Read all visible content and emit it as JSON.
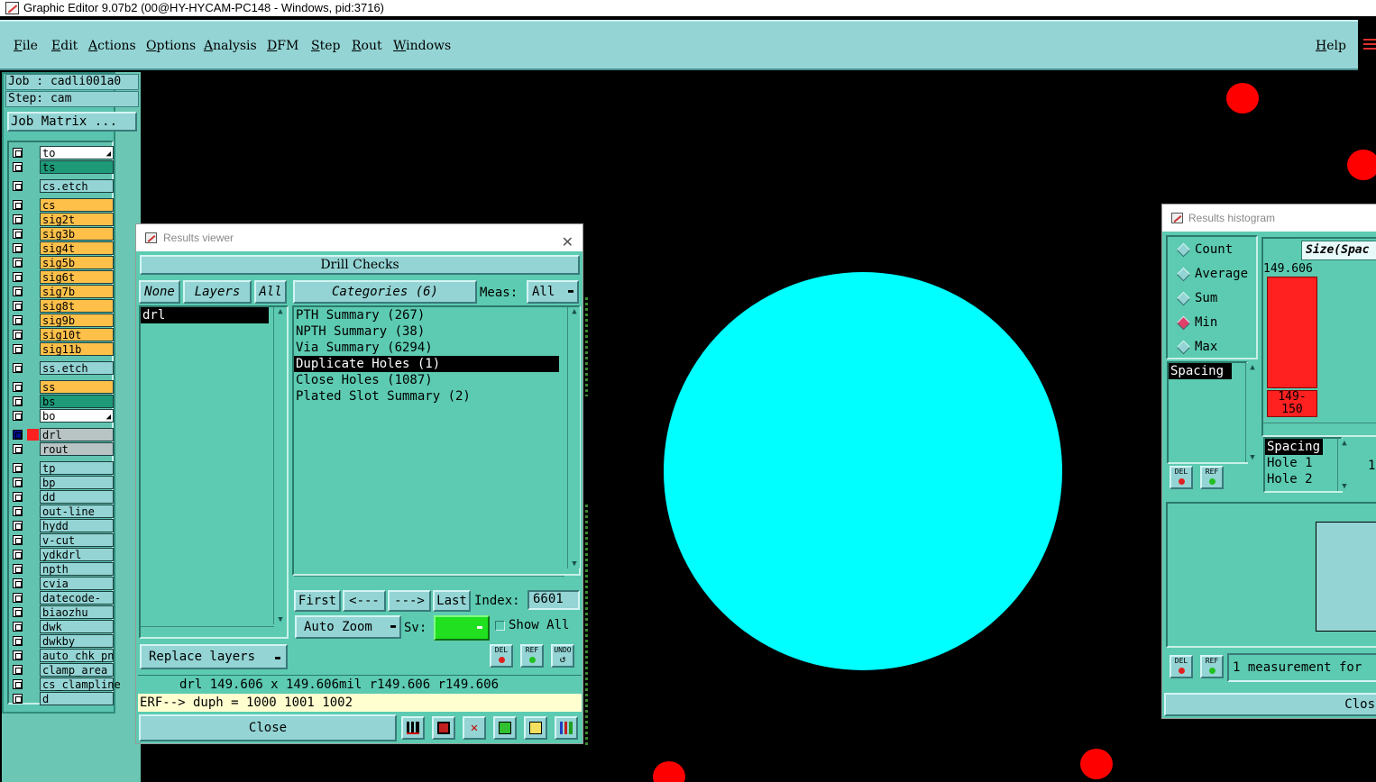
{
  "window": {
    "title": "Graphic Editor 9.07b2 (00@HY-HYCAM-PC148 - Windows, pid:3716)"
  },
  "menu": {
    "items": [
      "File",
      "Edit",
      "Actions",
      "Options",
      "Analysis",
      "DFM",
      "Step",
      "Rout",
      "Windows"
    ],
    "help": "Help"
  },
  "left_panel": {
    "job": "Job : cadli001a0",
    "step": "Step: cam",
    "job_matrix": "Job Matrix ...",
    "layers": [
      "to",
      "ts",
      "cs.etch",
      "cs",
      "sig2t",
      "sig3b",
      "sig4t",
      "sig5b",
      "sig6t",
      "sig7b",
      "sig8t",
      "sig9b",
      "sig10t",
      "sig11b",
      "ss.etch",
      "ss",
      "bs",
      "bo",
      "drl",
      "rout",
      "tp",
      "bp",
      "dd",
      "out-line",
      "hydd",
      "v-cut",
      "ydkdrl",
      "npth",
      "cvia",
      "datecode-to",
      "biaozhu",
      "dwk",
      "dwkby",
      "auto_chk_pn",
      "clamp_area",
      "cs_clampline",
      "d"
    ],
    "colors": {
      "white": "#ffffff",
      "teal_dark": "#1e9a78",
      "yellow": "#ffc04a",
      "light_teal": "#94d4d4",
      "grey": "#b8c4c4",
      "active_blue": "#00108c",
      "active_red": "#ff2020"
    }
  },
  "results_viewer": {
    "title": "Results viewer",
    "section": "Drill Checks",
    "none_btn": "None",
    "layers_btn": "Layers",
    "all_btn": "All",
    "layer_items": [
      "drl"
    ],
    "categories_btn": "Categories (6)",
    "meas_label": "Meas:",
    "meas_value": "All",
    "categories": [
      "PTH Summary (267)",
      "NPTH Summary (38)",
      "Via Summary (6294)",
      "Duplicate Holes (1)",
      "Close Holes (1087)",
      "Plated Slot Summary (2)"
    ],
    "selected_category": 3,
    "first": "First",
    "prev": "<---",
    "next": "--->",
    "last": "Last",
    "index_label": "Index:",
    "index_value": "6601",
    "auto_zoom": "Auto Zoom",
    "sv_label": "Sv:",
    "show_all": "Show All",
    "replace_layers": "Replace layers",
    "del": "DEL",
    "ref": "REF",
    "undo": "UNDO",
    "status": "drl 149.606 x 149.606mil  r149.606  r149.606",
    "erf": "ERF--> duph = 1000 1001 1002",
    "close": "Close"
  },
  "results_histogram": {
    "title": "Results histogram",
    "options": [
      "Count",
      "Average",
      "Sum",
      "Min",
      "Max"
    ],
    "selected_option": "Min",
    "size_label": "Size(Spac",
    "bar_value": "149.606",
    "bar_range": "149-\n150",
    "list_items": [
      "Spacing"
    ],
    "detail_items": [
      "Spacing",
      "Hole 1",
      "Hole 2"
    ],
    "detail_number": "1",
    "del": "DEL",
    "ref": "REF",
    "measurement_text": "1 measurement for",
    "close": "Clos"
  }
}
